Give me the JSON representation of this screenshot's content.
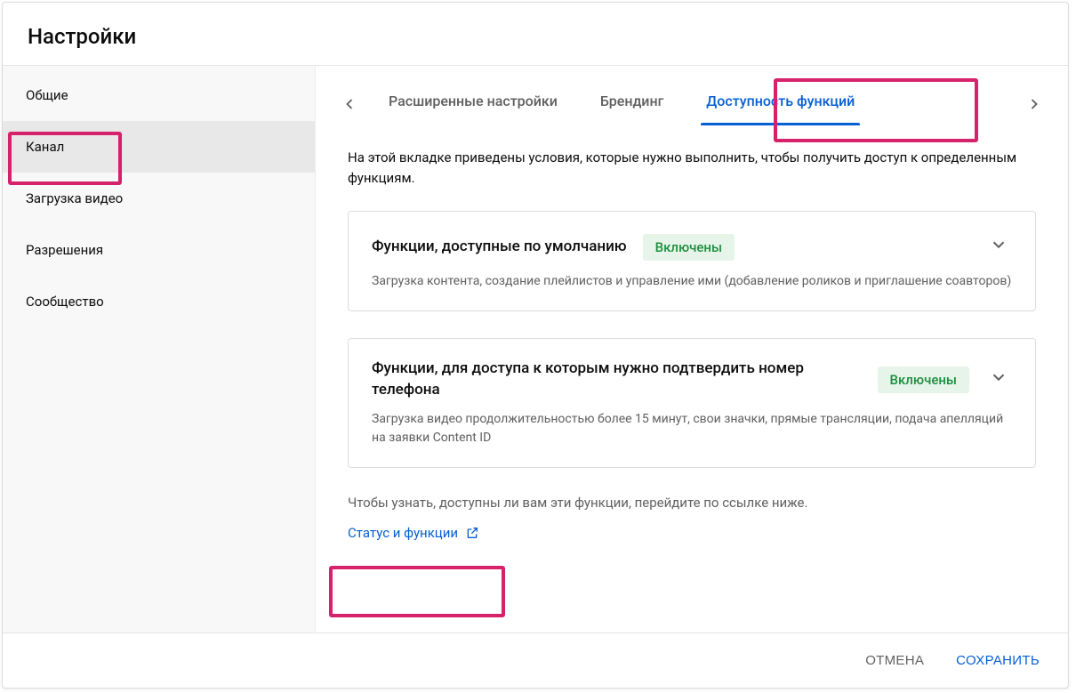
{
  "header": {
    "title": "Настройки"
  },
  "sidebar": {
    "items": [
      {
        "label": "Общие"
      },
      {
        "label": "Канал"
      },
      {
        "label": "Загрузка видео"
      },
      {
        "label": "Разрешения"
      },
      {
        "label": "Сообщество"
      }
    ],
    "active_index": 1
  },
  "tabs": {
    "items": [
      {
        "label": "Расширенные настройки"
      },
      {
        "label": "Брендинг"
      },
      {
        "label": "Доступность функций"
      }
    ],
    "active_index": 2
  },
  "intro": "На этой вкладке приведены условия, которые нужно выполнить, чтобы получить доступ к определенным функциям.",
  "cards": [
    {
      "title": "Функции, доступные по умолчанию",
      "badge": "Включены",
      "desc": "Загрузка контента, создание плейлистов и управление ими (добавление роликов и приглашение соавторов)"
    },
    {
      "title": "Функции, для доступа к которым нужно подтвердить номер телефона",
      "badge": "Включены",
      "desc": "Загрузка видео продолжительностью более 15 минут, свои значки, прямые трансляции, подача апелляций на заявки Content ID"
    }
  ],
  "hint": "Чтобы узнать, доступны ли вам эти функции, перейдите по ссылке ниже.",
  "link": {
    "label": "Статус и функции"
  },
  "footer": {
    "cancel": "ОТМЕНА",
    "save": "СОХРАНИТЬ"
  }
}
